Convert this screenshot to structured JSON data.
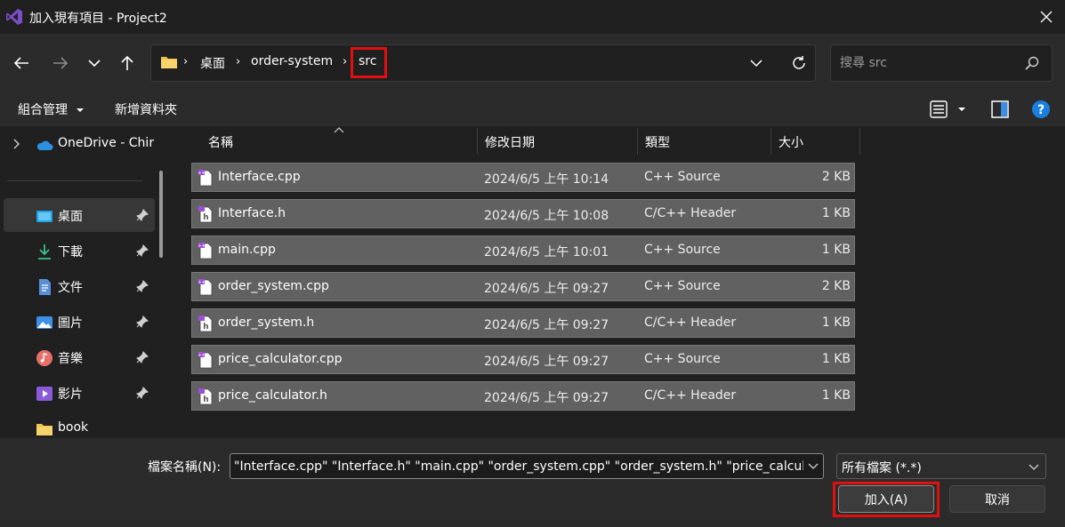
{
  "window": {
    "title": "加入現有項目 - Project2",
    "app_icon": "visual-studio-logo",
    "close_icon": "close-icon"
  },
  "nav": {
    "back_icon": "arrow-left-icon",
    "forward_icon": "arrow-right-icon",
    "recent_icon": "chevron-down-icon",
    "up_icon": "arrow-up-icon",
    "breadcrumbs": [
      "桌面",
      "order-system",
      "src"
    ],
    "refresh_icon": "refresh-icon"
  },
  "search": {
    "placeholder": "搜尋 src",
    "icon": "search-icon"
  },
  "toolbar": {
    "organize_label": "組合管理",
    "new_folder_label": "新增資料夾",
    "view_icon": "list-view-icon",
    "preview_icon": "preview-pane-icon",
    "help_icon": "help-icon"
  },
  "sidebar": {
    "items": [
      {
        "label": "OneDrive - Chir",
        "icon": "onedrive-cloud-icon",
        "pinned": false
      },
      {
        "label": "桌面",
        "icon": "desktop-icon",
        "pinned": true
      },
      {
        "label": "下載",
        "icon": "download-icon",
        "pinned": true
      },
      {
        "label": "文件",
        "icon": "document-icon",
        "pinned": true
      },
      {
        "label": "圖片",
        "icon": "pictures-icon",
        "pinned": true
      },
      {
        "label": "音樂",
        "icon": "music-icon",
        "pinned": true
      },
      {
        "label": "影片",
        "icon": "videos-icon",
        "pinned": true
      },
      {
        "label": "book",
        "icon": "folder-icon",
        "pinned": false
      }
    ]
  },
  "columns": {
    "name": "名稱",
    "date": "修改日期",
    "type": "類型",
    "size": "大小"
  },
  "files": [
    {
      "name": "Interface.cpp",
      "date": "2024/6/5 上午 10:14",
      "type": "C++ Source",
      "size": "2 KB",
      "icon": "cpp-file-icon"
    },
    {
      "name": "Interface.h",
      "date": "2024/6/5 上午 10:08",
      "type": "C/C++ Header",
      "size": "1 KB",
      "icon": "header-file-icon"
    },
    {
      "name": "main.cpp",
      "date": "2024/6/5 上午 10:01",
      "type": "C++ Source",
      "size": "1 KB",
      "icon": "cpp-file-icon"
    },
    {
      "name": "order_system.cpp",
      "date": "2024/6/5 上午 09:27",
      "type": "C++ Source",
      "size": "2 KB",
      "icon": "cpp-file-icon"
    },
    {
      "name": "order_system.h",
      "date": "2024/6/5 上午 09:27",
      "type": "C/C++ Header",
      "size": "1 KB",
      "icon": "header-file-icon"
    },
    {
      "name": "price_calculator.cpp",
      "date": "2024/6/5 上午 09:27",
      "type": "C++ Source",
      "size": "1 KB",
      "icon": "cpp-file-icon"
    },
    {
      "name": "price_calculator.h",
      "date": "2024/6/5 上午 09:27",
      "type": "C/C++ Header",
      "size": "1 KB",
      "icon": "header-file-icon"
    }
  ],
  "bottom": {
    "filename_label": "檔案名稱(N):",
    "filename_value": "\"Interface.cpp\" \"Interface.h\" \"main.cpp\" \"order_system.cpp\" \"order_system.h\" \"price_calculato",
    "filetype_value": "所有檔案 (*.*)",
    "add_label": "加入(A)",
    "cancel_label": "取消"
  },
  "colors": {
    "highlight_box": "#e01010",
    "selected_row": "#616161",
    "accent_blue": "#0078d4"
  }
}
